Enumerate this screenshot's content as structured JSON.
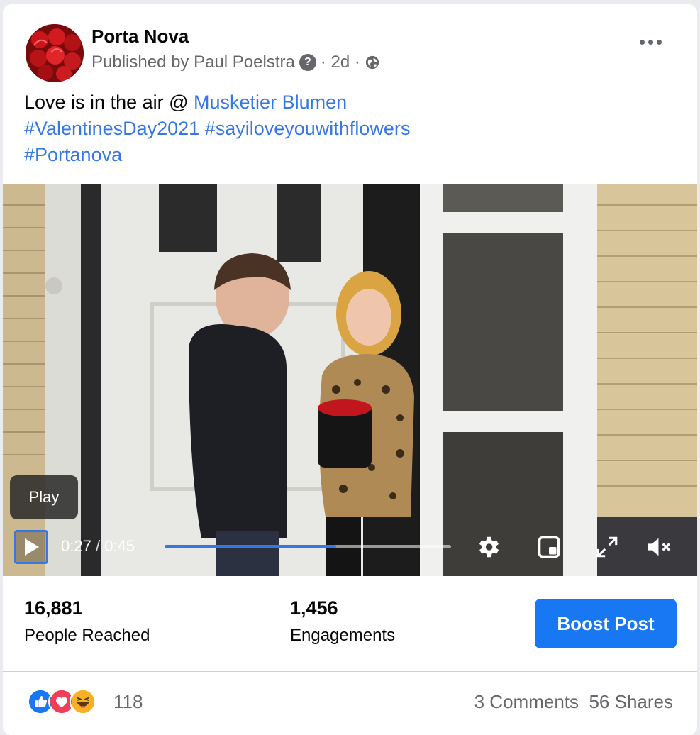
{
  "post": {
    "page_name": "Porta Nova",
    "published_by": "Published by Paul Poelstra",
    "help_icon": "?",
    "age": "· 2d ·",
    "privacy_icon": "globe-icon",
    "more_icon": "more-dots-icon",
    "caption_text": "Love is in the air @ ",
    "mention": "Musketier Blumen",
    "hashtags": [
      "#ValentinesDay2021",
      "#sayiloveyouwithflowers",
      "#Portanova"
    ]
  },
  "video": {
    "tooltip": "Play",
    "current_time": "0:27",
    "separator": "/",
    "duration": "0:45",
    "progress": 0.6,
    "controls": [
      "settings-icon",
      "picture-in-picture-icon",
      "fullscreen-icon",
      "mute-icon"
    ]
  },
  "stats": {
    "reached_value": "16,881",
    "reached_label": "People Reached",
    "engagements_value": "1,456",
    "engagements_label": "Engagements",
    "boost_label": "Boost Post"
  },
  "footer": {
    "reaction_icons": [
      "like-icon",
      "love-icon",
      "haha-icon"
    ],
    "reaction_count": "118",
    "comments": "3 Comments",
    "shares": "56 Shares"
  },
  "colors": {
    "link": "#3578e5",
    "boost": "#1877f2",
    "muted": "#65676b"
  }
}
